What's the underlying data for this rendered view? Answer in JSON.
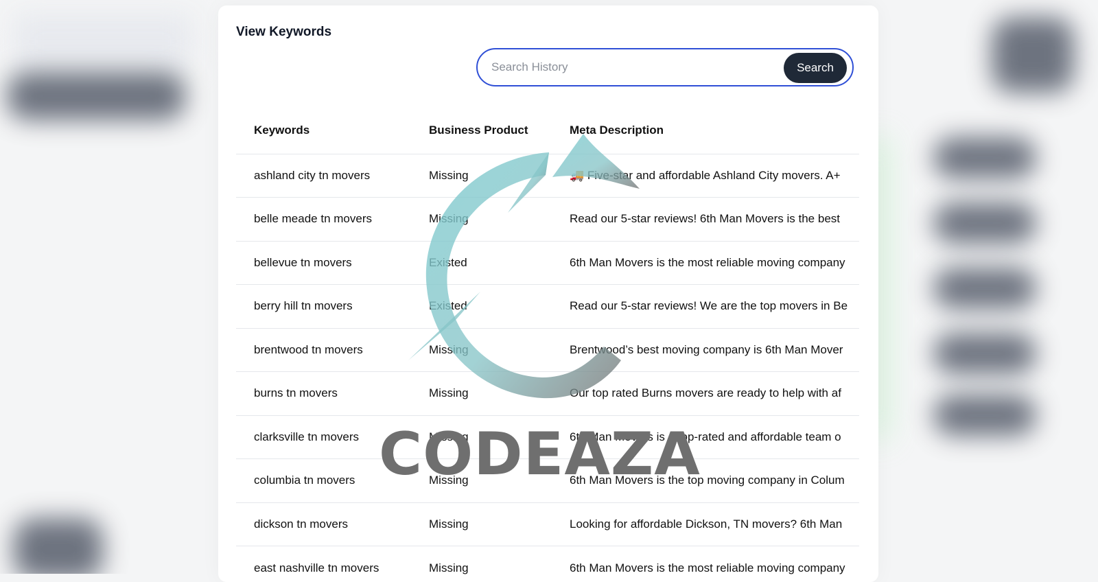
{
  "page": {
    "title": "View Keywords"
  },
  "search": {
    "placeholder": "Search History",
    "value": "",
    "button_label": "Search"
  },
  "table": {
    "headers": [
      "Keywords",
      "Business Product",
      "Meta Description"
    ],
    "rows": [
      {
        "keyword": "ashland city tn movers",
        "product": "Missing",
        "meta": "🚚 Five-star and affordable Ashland City movers. A+"
      },
      {
        "keyword": "belle meade tn movers",
        "product": "Missing",
        "meta": "Read our 5-star reviews! 6th Man Movers is the best"
      },
      {
        "keyword": "bellevue tn movers",
        "product": "Existed",
        "meta": "6th Man Movers is the most reliable moving company"
      },
      {
        "keyword": "berry hill tn movers",
        "product": "Existed",
        "meta": "Read our 5-star reviews! We are the top movers in Be"
      },
      {
        "keyword": "brentwood tn movers",
        "product": "Missing",
        "meta": "Brentwood’s best moving company is 6th Man Mover"
      },
      {
        "keyword": "burns tn movers",
        "product": "Missing",
        "meta": "Our top rated Burns movers are ready to help with af"
      },
      {
        "keyword": "clarksville tn movers",
        "product": "Missing",
        "meta": "6th Man Movers is a top-rated and affordable team o"
      },
      {
        "keyword": "columbia tn movers",
        "product": "Missing",
        "meta": "6th Man Movers is the top moving company in Colum"
      },
      {
        "keyword": "dickson tn movers",
        "product": "Missing",
        "meta": "Looking for affordable Dickson, TN movers? 6th Man"
      },
      {
        "keyword": "east nashville tn movers",
        "product": "Missing",
        "meta": "6th Man Movers is the most reliable moving company"
      }
    ]
  },
  "watermark": {
    "text": "CODEAZA",
    "icon": "refresh-arrows-icon",
    "colors": {
      "teal": "#7fcbd0",
      "gray": "#727272"
    }
  },
  "colors": {
    "search_border": "#2f4fd6",
    "search_button": "#1f2937",
    "row_divider": "#e5e7eb"
  }
}
